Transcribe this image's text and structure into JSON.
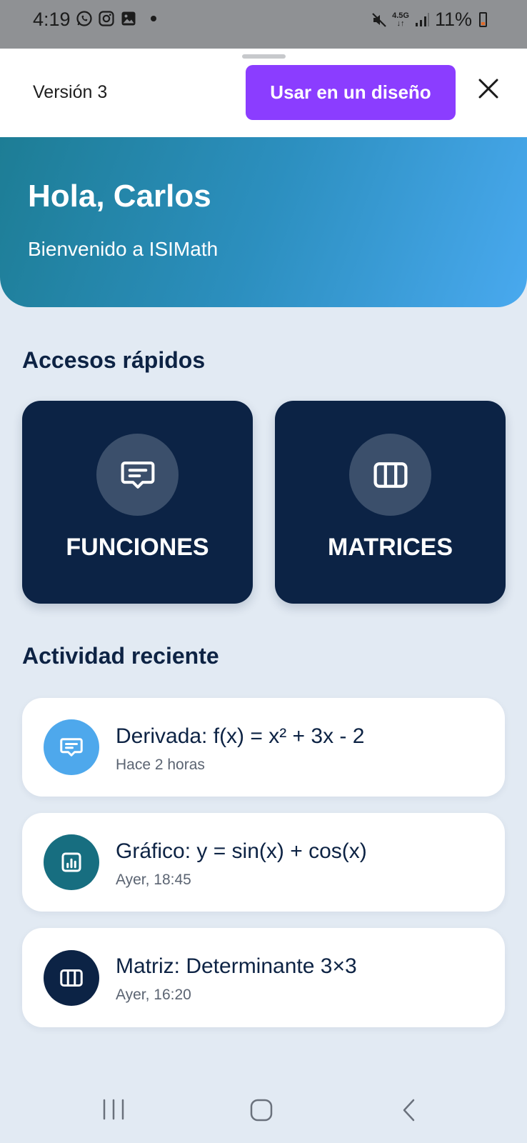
{
  "status_bar": {
    "time": "4:19",
    "network": "4.5G",
    "battery": "11%",
    "left_icons": [
      "whatsapp-icon",
      "instagram-icon",
      "gallery-icon",
      "dot-indicator"
    ],
    "right_icons": [
      "mute-icon",
      "network-arrows-icon",
      "signal-icon",
      "battery-icon"
    ]
  },
  "sheet_header": {
    "version": "Versión 3",
    "use_button": "Usar en un diseño",
    "close_icon": "close-icon",
    "accent_color": "#8b3dff"
  },
  "hero": {
    "greeting": "Hola, Carlos",
    "subtitle": "Bienvenido a ISIMath",
    "gradient_colors": [
      "#1d7d95",
      "#49a9ef"
    ]
  },
  "quick_access": {
    "title": "Accesos rápidos",
    "cards": [
      {
        "label": "FUNCIONES",
        "icon": "message-icon"
      },
      {
        "label": "MATRICES",
        "icon": "columns-icon"
      }
    ],
    "card_color": "#0c2345"
  },
  "recent_activity": {
    "title": "Actividad reciente",
    "items": [
      {
        "title": "Derivada: f(x) = x² + 3x - 2",
        "time": "Hace 2 horas",
        "icon": "message-icon",
        "icon_color": "#4ea8ec"
      },
      {
        "title": "Gráfico: y = sin(x) + cos(x)",
        "time": "Ayer, 18:45",
        "icon": "chart-icon",
        "icon_color": "#176e80"
      },
      {
        "title": "Matriz: Determinante 3×3",
        "time": "Ayer, 16:20",
        "icon": "columns-icon",
        "icon_color": "#0c2345"
      }
    ]
  },
  "nav_bar": {
    "buttons": [
      "recents-icon",
      "home-icon",
      "back-icon"
    ]
  }
}
